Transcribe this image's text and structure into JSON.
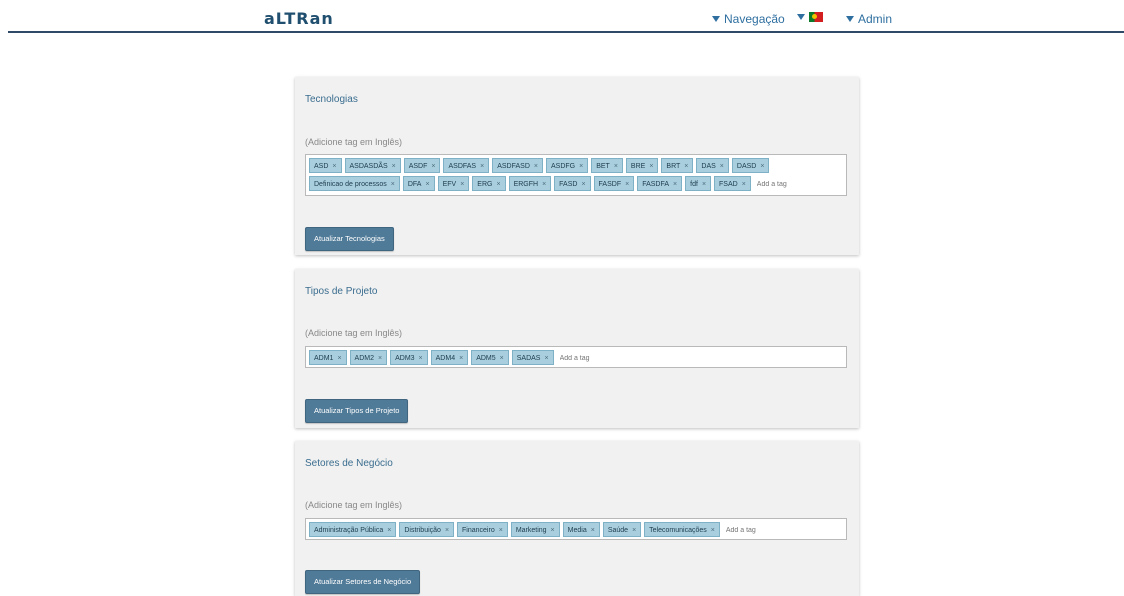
{
  "header": {
    "logo_text": "aLTRan",
    "nav_label": "Navegação",
    "admin_label": "Admin"
  },
  "common": {
    "hint": "(Adicione tag em Inglês)",
    "add_placeholder": "Add a tag",
    "remove_glyph": "×"
  },
  "sections": [
    {
      "title": "Tecnologias",
      "tags": [
        "ASD",
        "ASDASDÃS",
        "ASDF",
        "ASDFAS",
        "ASDFASD",
        "ASDFG",
        "BET",
        "BRE",
        "BRT",
        "DAS",
        "DASD",
        "Definicao de processos",
        "DFA",
        "EFV",
        "ERG",
        "ERGFH",
        "FASD",
        "FASDF",
        "FASDFA",
        "fdf",
        "FSAD"
      ],
      "button": "Atualizar Tecnologias"
    },
    {
      "title": "Tipos de Projeto",
      "tags": [
        "ADM1",
        "ADM2",
        "ADM3",
        "ADM4",
        "ADM5",
        "SADAS"
      ],
      "button": "Atualizar Tipos de Projeto"
    },
    {
      "title": "Setores de Negócio",
      "tags": [
        "Administração Pública",
        "Distribuição",
        "Financeiro",
        "Marketing",
        "Media",
        "Saúde",
        "Telecomunicações"
      ],
      "button": "Atualizar Setores de Negócio"
    }
  ]
}
